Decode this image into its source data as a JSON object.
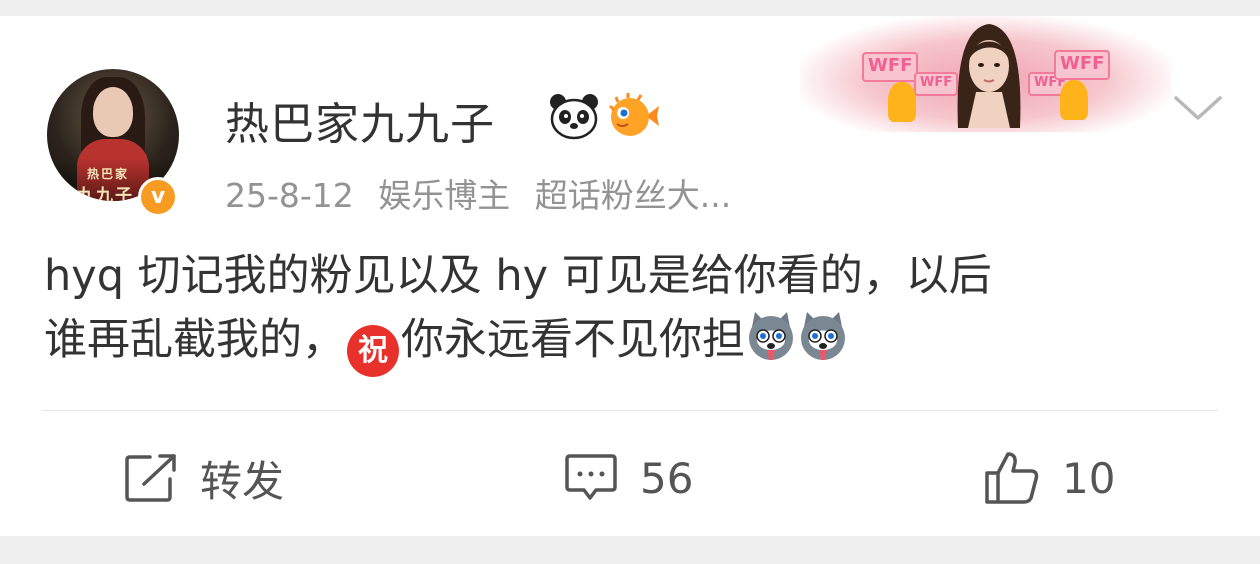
{
  "post": {
    "author": {
      "name": "热巴家九九子",
      "avatar_caption_top": "热巴家",
      "avatar_caption_bottom": "九九子",
      "verified_mark": "v"
    },
    "meta": {
      "date": "25-8-12",
      "role": "娱乐博主",
      "fan_title": "超话粉丝大..."
    },
    "banner": {
      "sign_text": "WFF"
    },
    "content": {
      "line1": "hyq 切记我的粉见以及 hy 可见是给你看的，以后",
      "line2_before": "谁再乱截我的，",
      "emoji_zhu": "祝",
      "line2_after": "你永远看不见你担"
    },
    "actions": {
      "repost_label": "转发",
      "comments_count": "56",
      "likes_count": "10"
    }
  },
  "icons": {
    "badge1": "panda-icon",
    "badge2": "pufferfish-icon",
    "repost": "share-icon",
    "comment": "comment-icon",
    "like": "thumbs-up-icon",
    "more": "chevron-down-icon",
    "emoji": "husky-emoji-icon"
  },
  "colors": {
    "verified": "#f89b22",
    "zhu_emoji": "#e8312a",
    "text_primary": "#333333",
    "text_meta": "#939393"
  }
}
